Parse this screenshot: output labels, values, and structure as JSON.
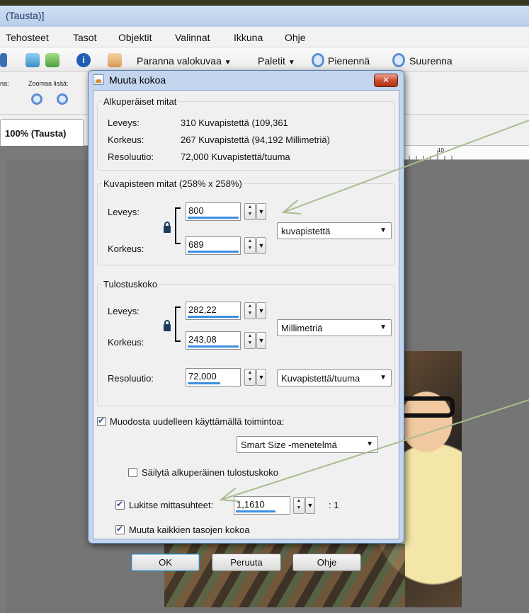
{
  "app": {
    "title": "(Tausta)]",
    "menu": [
      "Tehosteet",
      "Tasot",
      "Objektit",
      "Valinnat",
      "Ikkuna",
      "Ohje"
    ],
    "toolbar": {
      "enhance_label": "Paranna valokuvaa",
      "palettes_label": "Paletit",
      "zoom_out_label": "Pienennä",
      "zoom_in_label": "Suurenna"
    },
    "toolbar2": {
      "left_label": "na:",
      "zoom_more_label": "Zoomaa lisää:"
    },
    "tab_label": "100% (Tausta)",
    "ruler_mark": "10"
  },
  "dialog": {
    "title": "Muuta kokoa",
    "close_symbol": "✕",
    "original": {
      "legend": "Alkuperäiset mitat",
      "width_label": "Leveys:",
      "width_value": "310 Kuvapistettä (109,361",
      "height_label": "Korkeus:",
      "height_value": "267 Kuvapistettä (94,192 Millimetriä)",
      "resolution_label": "Resoluutio:",
      "resolution_value": "72,000 Kuvapistettä/tuuma"
    },
    "pixel": {
      "legend": "Kuvapisteen mitat (258% x 258%)",
      "width_label": "Leveys:",
      "width_value": "800",
      "height_label": "Korkeus:",
      "height_value": "689",
      "unit": "kuvapistettä"
    },
    "print": {
      "legend": "Tulostuskoko",
      "width_label": "Leveys:",
      "width_value": "282,22",
      "height_label": "Korkeus:",
      "height_value": "243,08",
      "unit": "Millimetriä",
      "resolution_label": "Resoluutio:",
      "resolution_value": "72,000",
      "resolution_unit": "Kuvapistettä/tuuma"
    },
    "resample": {
      "label": "Muodosta uudelleen käyttämällä toimintoa:",
      "checked": true,
      "method": "Smart Size -menetelmä"
    },
    "keep_print_size": {
      "label": "Säilytä alkuperäinen tulostuskoko",
      "checked": false
    },
    "lock_ratio": {
      "label": "Lukitse mittasuhteet:",
      "checked": true,
      "value": "1,1610",
      "suffix": ": 1"
    },
    "resize_all_layers": {
      "label": "Muuta kaikkien tasojen kokoa",
      "checked": true
    },
    "buttons": {
      "ok": "OK",
      "cancel": "Peruuta",
      "help": "Ohje"
    }
  },
  "colors": {
    "annotation_arrow": "#a8bd8f",
    "progress_bar": "#3d8fe0",
    "dialog_frame": "#c3d6ee"
  }
}
